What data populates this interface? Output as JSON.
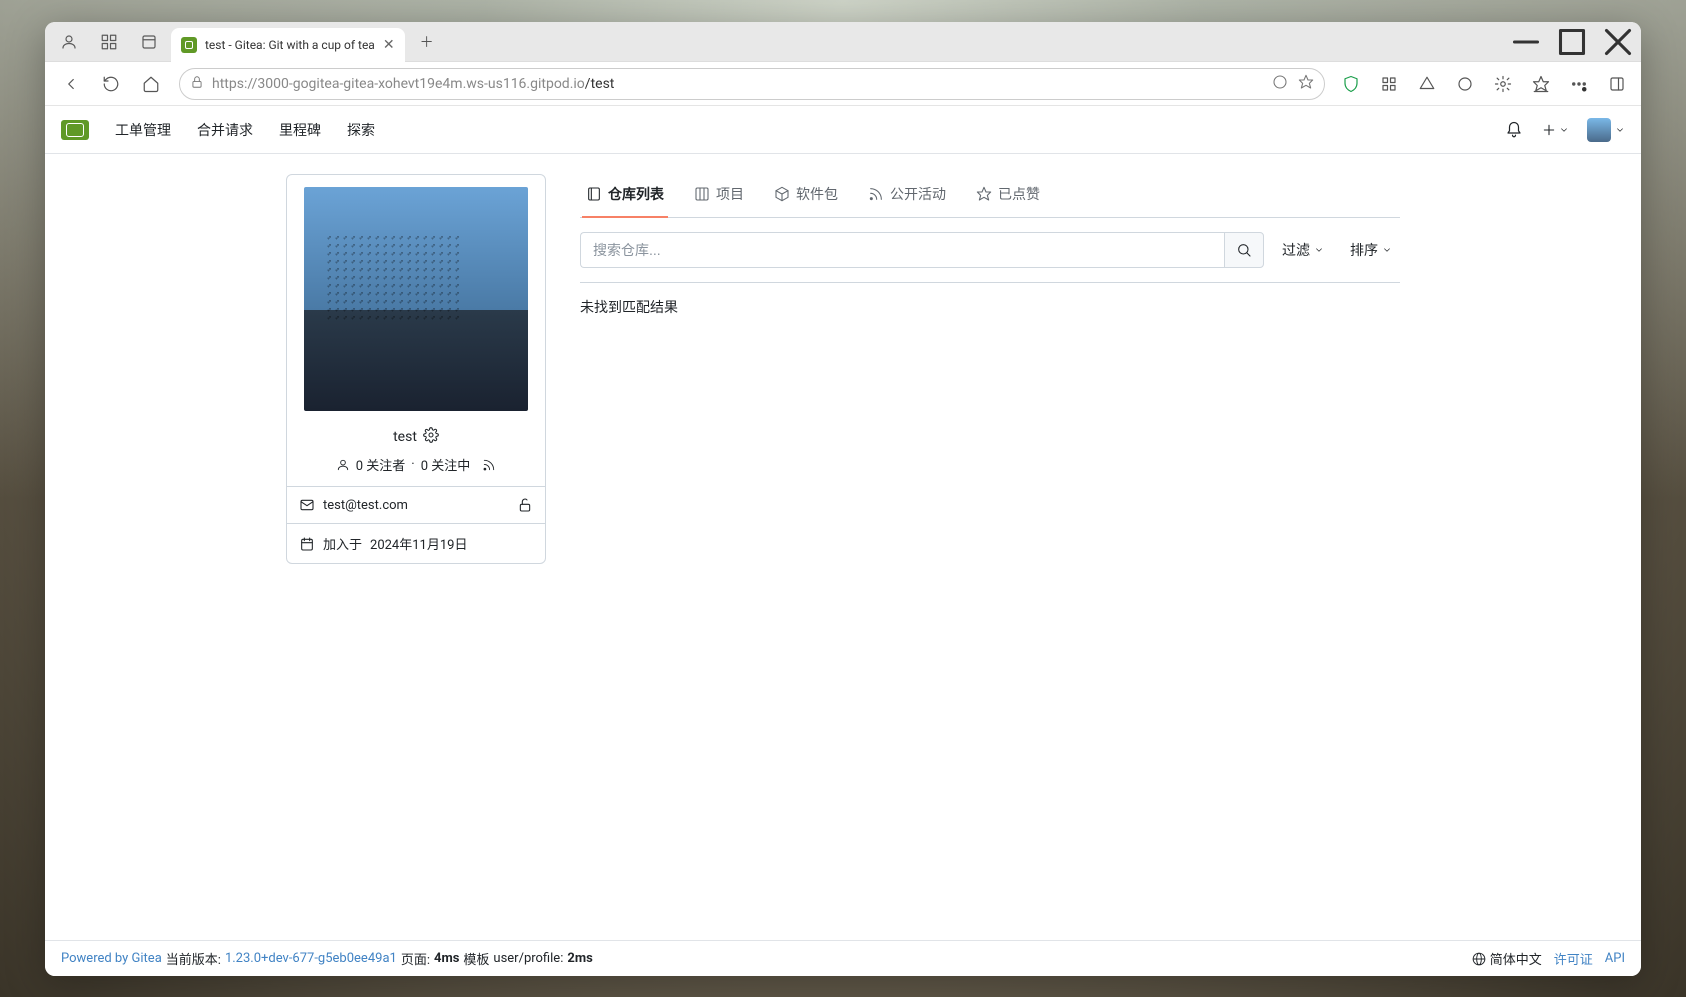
{
  "browser": {
    "tab_title": "test - Gitea: Git with a cup of tea",
    "url_host": "https://3000-gogitea-gitea-xohevt19e4m.ws-us116.gitpod.io",
    "url_path": "/test"
  },
  "nav": {
    "items": [
      "工单管理",
      "合并请求",
      "里程碑",
      "探索"
    ]
  },
  "profile": {
    "username": "test",
    "followers_text": "0 关注者",
    "following_text": "0 关注中",
    "separator": "·",
    "email": "test@test.com",
    "joined_label": "加入于",
    "joined_date": "2024年11月19日"
  },
  "tabs": {
    "repos": "仓库列表",
    "projects": "项目",
    "packages": "软件包",
    "activity": "公开活动",
    "starred": "已点赞"
  },
  "search": {
    "placeholder": "搜索仓库...",
    "filter": "过滤",
    "sort": "排序"
  },
  "results": {
    "empty": "未找到匹配结果"
  },
  "footer": {
    "powered": "Powered by Gitea",
    "version_label": "当前版本:",
    "version": "1.23.0+dev-677-g5eb0ee49a1",
    "page_label": "页面:",
    "page_time": "4ms",
    "template_label": "模板",
    "template_name": "user/profile:",
    "template_time": "2ms",
    "language": "简体中文",
    "license": "许可证",
    "api": "API"
  }
}
